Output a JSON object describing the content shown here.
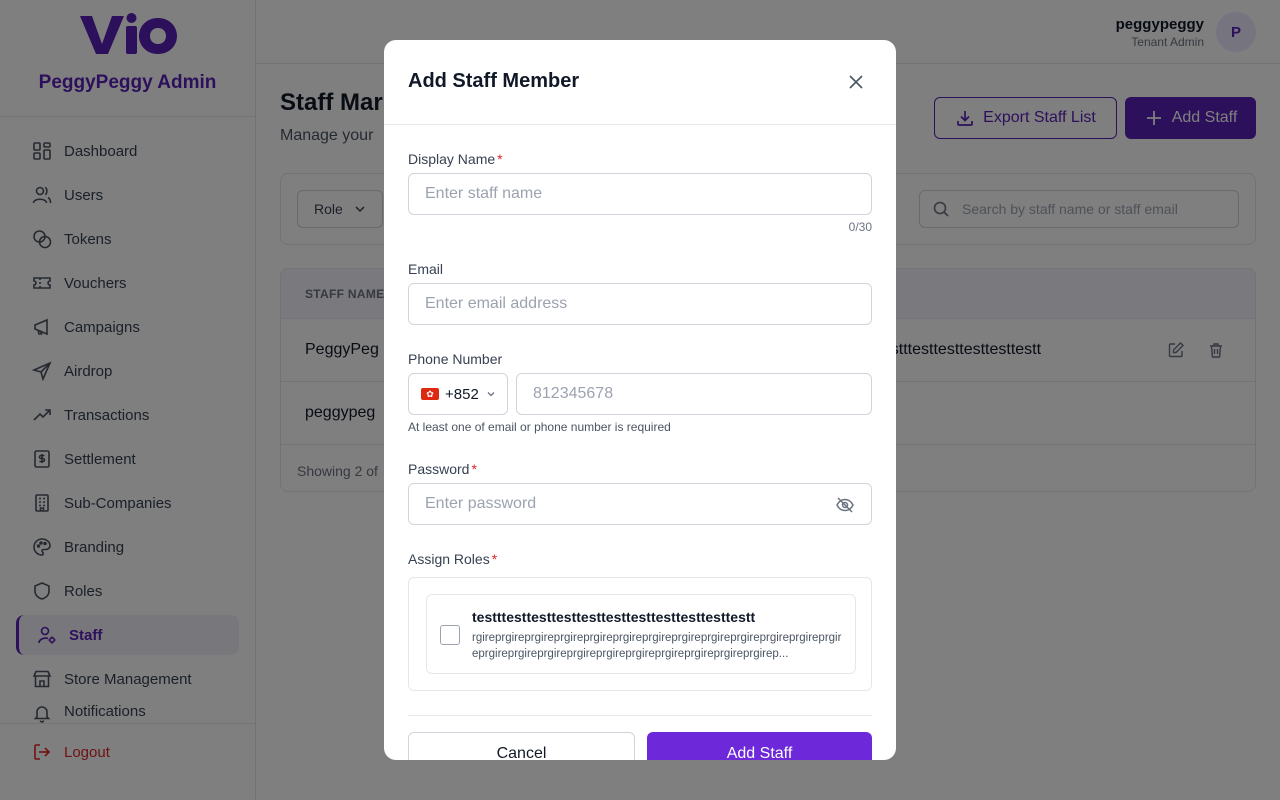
{
  "sidebar": {
    "logo_text": "ViO",
    "brand_name": "PeggyPeggy Admin",
    "items": [
      {
        "label": "Dashboard"
      },
      {
        "label": "Users"
      },
      {
        "label": "Tokens"
      },
      {
        "label": "Vouchers"
      },
      {
        "label": "Campaigns"
      },
      {
        "label": "Airdrop"
      },
      {
        "label": "Transactions"
      },
      {
        "label": "Settlement"
      },
      {
        "label": "Sub-Companies"
      },
      {
        "label": "Branding"
      },
      {
        "label": "Roles"
      },
      {
        "label": "Staff"
      },
      {
        "label": "Store Management"
      },
      {
        "label": "Notifications"
      }
    ],
    "active_item": "Staff",
    "logout_label": "Logout"
  },
  "header": {
    "user_name": "peggypeggy",
    "user_role": "Tenant Admin",
    "avatar_initial": "P"
  },
  "main": {
    "title": "Staff Mar",
    "subtitle": "Manage your",
    "export_label": "Export Staff List",
    "add_label": "Add Staff",
    "role_filter_label": "Role",
    "search_placeholder": "Search by staff name or staff email",
    "table": {
      "column_staff_name": "STAFF NAME",
      "rows": [
        {
          "name": "PeggyPeg",
          "email": "ttestttesttesttesttesttestt"
        },
        {
          "name": "peggypeg",
          "email": ""
        }
      ],
      "footer": "Showing 2 of"
    }
  },
  "modal": {
    "title": "Add Staff Member",
    "display_name": {
      "label": "Display Name",
      "required": "*",
      "placeholder": "Enter staff name",
      "counter": "0/30"
    },
    "email": {
      "label": "Email",
      "placeholder": "Enter email address"
    },
    "phone": {
      "label": "Phone Number",
      "country_code": "+852",
      "placeholder": "812345678",
      "hint": "At least one of email or phone number is required"
    },
    "password": {
      "label": "Password",
      "required": "*",
      "placeholder": "Enter password"
    },
    "roles": {
      "label": "Assign Roles",
      "required": "*",
      "items": [
        {
          "name": "testttesttesttesttesttesttesttesttesttesttestt",
          "description": "rgireprgireprgireprgireprgireprgireprgireprgireprgireprgireprgireprgireprgireprgireprgireprgireprgireprgireprgireprgireprgireprgireprgirep..."
        }
      ]
    },
    "cancel_label": "Cancel",
    "submit_label": "Add Staff"
  },
  "colors": {
    "brand": "#5b21b6",
    "accent_button": "#6d28d9",
    "danger": "#dc2626"
  }
}
